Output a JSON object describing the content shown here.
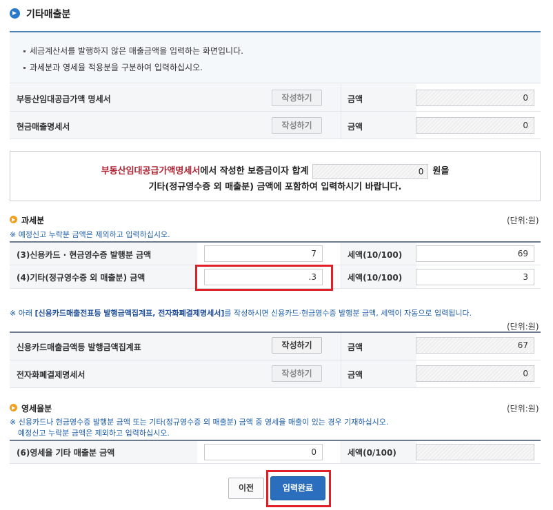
{
  "title": "기타매출분",
  "info": [
    "세금계산서를 발행하지 않은 매출금액을 입력하는 화면입니다.",
    "과세분과 영세율 적용분을 구분하여 입력하십시오."
  ],
  "top_rows": [
    {
      "label": "부동산임대공급가액 명세서",
      "button": "작성하기",
      "amount_label": "금액",
      "amount": "0"
    },
    {
      "label": "현금매출명세서",
      "button": "작성하기",
      "amount_label": "금액",
      "amount": "0"
    }
  ],
  "notice": {
    "red": "부동산임대공급가액명세서",
    "part1": "에서 작성한 보증금이자 합계",
    "value": "0",
    "part2": "원을",
    "line2": "기타(정규영수증 외 매출분) 금액에 포함하여 입력하시기 바랍니다."
  },
  "taxable": {
    "title": "과세분",
    "unit": "(단위:원)",
    "note": "※ 예정신고 누락분 금액은 제외하고 입력하십시오.",
    "rows": [
      {
        "label": "(3)신용카드 · 현금영수증 발행분 금액",
        "amount": "7",
        "tax_label": "세액(10/100)",
        "tax": "69"
      },
      {
        "label": "(4)기타(정규영수증 외 매출분) 금액",
        "amount": ".3",
        "tax_label": "세액(10/100)",
        "tax": "3"
      }
    ]
  },
  "card_note": {
    "prefix": "※ 아래 ",
    "bold": "[신용카드매출전표등 발행금액집계표, 전자화폐결제명세서]",
    "suffix": "를 작성하시면 신용카드·현금영수증 발행분 금액, 세액이 자동으로 입력됩니다.",
    "unit": "(단위:원)"
  },
  "card_rows": [
    {
      "label": "신용카드매출금액등 발행금액집계표",
      "button": "작성하기",
      "amount_label": "금액",
      "amount": "67"
    },
    {
      "label": "전자화폐결제명세서",
      "button": "작성하기",
      "amount_label": "금액",
      "amount": "0"
    }
  ],
  "zero_rate": {
    "title": "영세율분",
    "unit": "(단위:원)",
    "note1": "※ 신용카드나 현금영수증 발행분 금액 또는 기타(정규영수증 외 매출분) 금액 중 영세율 매출이 있는 경우 기재하십시오.",
    "note2": "예정신고 누락분 금액은 제외하고 입력하십시오.",
    "row": {
      "label": "(6)영세율 기타 매출분 금액",
      "amount": "0",
      "tax_label": "세액(0/100)",
      "tax": ""
    }
  },
  "buttons": {
    "prev": "이전",
    "submit": "입력완료"
  },
  "colors": {
    "accent": "#2a6ebd",
    "highlight": "#e01f26",
    "notice_red": "#b02030"
  }
}
